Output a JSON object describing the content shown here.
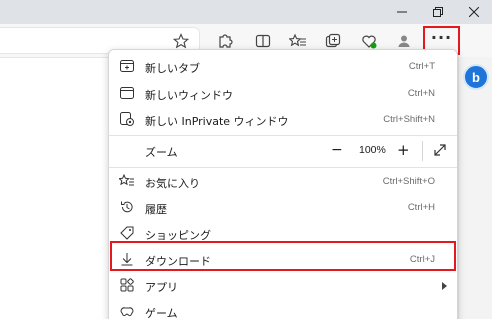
{
  "menu": {
    "items": [
      {
        "label": "新しいタブ",
        "shortcut": "Ctrl+T",
        "icon": "new-tab-icon"
      },
      {
        "label": "新しいウィンドウ",
        "shortcut": "Ctrl+N",
        "icon": "new-window-icon"
      },
      {
        "label": "新しい InPrivate ウィンドウ",
        "shortcut": "Ctrl+Shift+N",
        "icon": "inprivate-icon"
      },
      {
        "label": "お気に入り",
        "shortcut": "Ctrl+Shift+O",
        "icon": "favorites-icon"
      },
      {
        "label": "履歴",
        "shortcut": "Ctrl+H",
        "icon": "history-icon"
      },
      {
        "label": "ショッピング",
        "shortcut": "",
        "icon": "shopping-tag-icon"
      },
      {
        "label": "ダウンロード",
        "shortcut": "Ctrl+J",
        "icon": "download-icon"
      },
      {
        "label": "アプリ",
        "shortcut": "",
        "icon": "apps-icon"
      },
      {
        "label": "ゲーム",
        "shortcut": "",
        "icon": "games-icon"
      }
    ],
    "zoom": {
      "label": "ズーム",
      "minus": "−",
      "value": "100%",
      "plus": "+"
    }
  },
  "sidebar": {
    "bing_glyph": "b"
  },
  "toolbar": {
    "more_glyph": "···"
  },
  "colors": {
    "highlight": "#e3191e",
    "bing": "#1e74d8"
  }
}
